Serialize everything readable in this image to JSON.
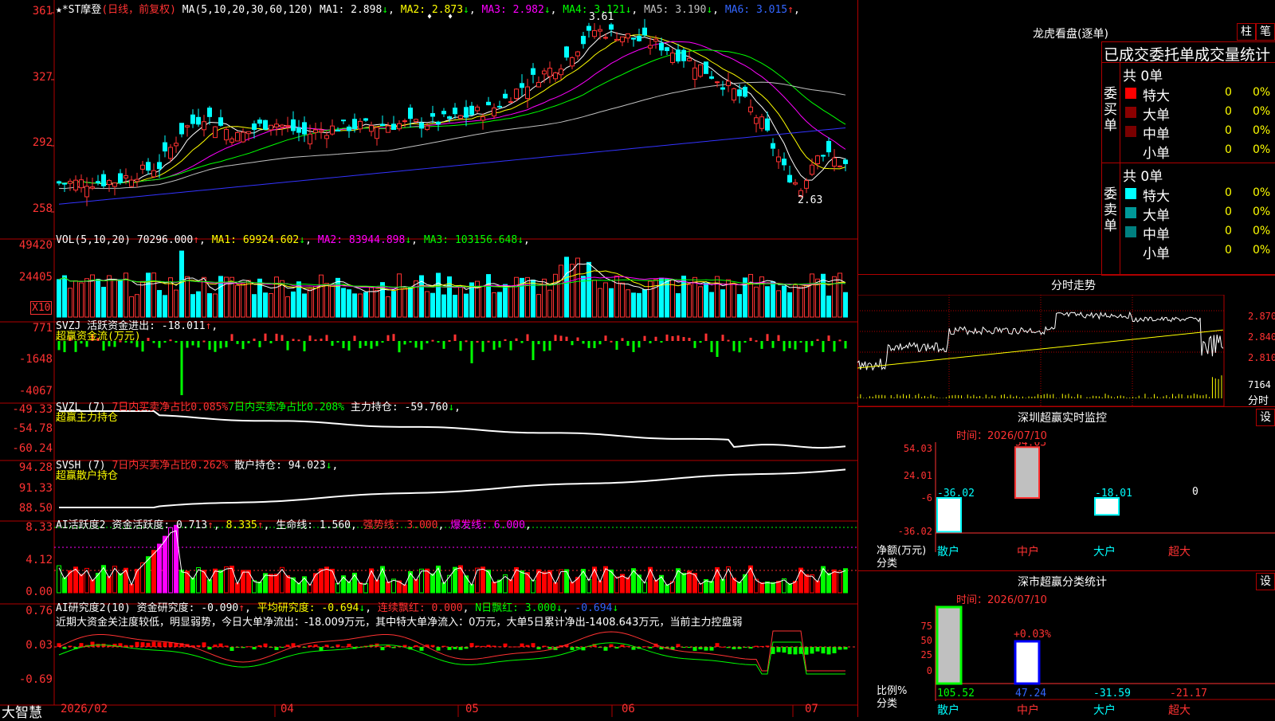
{
  "main": {
    "title": "★*ST摩登",
    "subtitle": "(日线，前复权)",
    "ma_label": "MA(5,10,20,30,60,120)",
    "ma": [
      {
        "name": "MA1:",
        "value": "2.898",
        "arrow": "↓",
        "color": "#ffffff"
      },
      {
        "name": "MA2:",
        "value": "2.873",
        "arrow": "↓",
        "color": "#ffff00"
      },
      {
        "name": "MA3:",
        "value": "2.982",
        "arrow": "↓",
        "color": "#ff00ff"
      },
      {
        "name": "MA4:",
        "value": "3.121",
        "arrow": "↓",
        "color": "#00ff00"
      },
      {
        "name": "MA5:",
        "value": "3.190",
        "arrow": "↓",
        "color": "#c0c0c0"
      },
      {
        "name": "MA6:",
        "value": "3.015",
        "arrow": "↑",
        "color": "#3366ff"
      }
    ],
    "y_labels": [
      "361",
      "327",
      "292",
      "258"
    ],
    "high_label": "3.61",
    "low_label": "2.63"
  },
  "vol": {
    "label": "VOL(5,10,20)",
    "value": "70296.000",
    "arrow": "↑",
    "ma": [
      {
        "name": "MA1:",
        "value": "69924.602",
        "arrow": "↓",
        "color": "#ffff00"
      },
      {
        "name": "MA2:",
        "value": "83944.898",
        "arrow": "↓",
        "color": "#ff00ff"
      },
      {
        "name": "MA3:",
        "value": "103156.648",
        "arrow": "↓",
        "color": "#00ff00"
      }
    ],
    "y_labels": [
      "49420",
      "24405"
    ],
    "unit": "X10"
  },
  "svzj": {
    "label": "SVZJ",
    "name": "活跃资金进出:",
    "value": "-18.011",
    "arrow": "↑",
    "sub": "超赢资金流(万元)",
    "y_labels": [
      "771",
      "-1648",
      "-4067"
    ]
  },
  "svzl": {
    "label": "SVZL (7)",
    "t1": "7日内买卖净占比0.085%",
    "t2": "7日内买卖净占比0.208%",
    "t3": "主力持仓:",
    "value": "-59.760",
    "arrow": "↓",
    "sub": "超赢主力持仓",
    "y_labels": [
      "-49.33",
      "-54.78",
      "-60.24"
    ]
  },
  "svsh": {
    "label": "SVSH (7)",
    "t1": "7日内买卖净占比0.262%",
    "t2": "散户持仓:",
    "value": "94.023",
    "arrow": "↓",
    "sub": "超赢散户持仓",
    "y_labels": [
      "94.28",
      "91.33",
      "88.50"
    ]
  },
  "ai1": {
    "label": "AI活跃度2",
    "t1": "资金活跃度:",
    "v1": "0.713",
    "v2": "8.335",
    "t3": "生命线:",
    "v3": "1.560",
    "t4": "强势线:",
    "v4": "3.000",
    "t5": "爆发线:",
    "v5": "6.000",
    "y_labels": [
      "8.33",
      "4.12",
      "0.00"
    ]
  },
  "ai2": {
    "label": "AI研究度2(10)",
    "t1": "资金研究度:",
    "v1": "-0.090",
    "t2": "平均研究度:",
    "v2": "-0.694",
    "t3": "连续飘红:",
    "v3": "0.000",
    "t4": "N日飘红:",
    "v4": "3.000",
    "v5": "-0.694",
    "comment": "近期大资金关注度较低，明显弱势，今日大单净流出：-18.009万元，其中特大单净流入：0万元，大单5日累计净出-1408.643万元，当前主力控盘弱",
    "y_labels": [
      "0.76",
      "0.03",
      "-0.69"
    ]
  },
  "xaxis": {
    "brand": "大智慧",
    "labels": [
      "2026/02",
      "04",
      "05",
      "06",
      "07"
    ]
  },
  "right": {
    "lhb_title": "龙虎看盘(逐单)",
    "btn_bar": "柱",
    "btn_pen": "笔",
    "stats_title": "已成交委托单成交量统计",
    "buy_label": "委买单",
    "sell_label": "委卖单",
    "buy_total": "共 0单",
    "sell_total": "共 0单",
    "buy_rows": [
      {
        "name": "特大",
        "count": "0",
        "pct": "0%",
        "color": "#ff0000"
      },
      {
        "name": "大单",
        "count": "0",
        "pct": "0%",
        "color": "#8b0000"
      },
      {
        "name": "中单",
        "count": "0",
        "pct": "0%",
        "color": "#7a0000"
      },
      {
        "name": "小单",
        "count": "0",
        "pct": "0%",
        "color": ""
      }
    ],
    "sell_rows": [
      {
        "name": "特大",
        "count": "0",
        "pct": "0%",
        "color": "#00ffff"
      },
      {
        "name": "大单",
        "count": "0",
        "pct": "0%",
        "color": "#009999"
      },
      {
        "name": "中单",
        "count": "0",
        "pct": "0%",
        "color": "#008080"
      },
      {
        "name": "小单",
        "count": "0",
        "pct": "0%",
        "color": ""
      }
    ],
    "intraday_title": "分时走势",
    "intraday_y": [
      "2.870",
      "2.840",
      "2.810"
    ],
    "intraday_vol": "7164",
    "intraday_vol_label": "分时",
    "monitor_title": "深圳超赢实时监控",
    "monitor_time": "时间：2026/07/10",
    "monitor_y": [
      "54.03",
      "24.01",
      "-6",
      "-36.02"
    ],
    "monitor_vals": [
      "-36.02",
      "54.03",
      "-18.01",
      "0"
    ],
    "monitor_unit": "净额(万元)",
    "monitor_cat_label": "分类",
    "monitor_cats": [
      "散户",
      "中户",
      "大户",
      "超大"
    ],
    "class_title": "深市超赢分类统计",
    "class_time": "时间：2026/07/10",
    "class_y": [
      "75",
      "50",
      "25",
      "0"
    ],
    "class_vals": [
      "105.52",
      "47.24",
      "-31.59",
      "-21.17"
    ],
    "class_top": "+0.03%",
    "class_unit": "比例%",
    "class_cat_label": "分类",
    "class_cats": [
      "散户",
      "中户",
      "大户",
      "超大"
    ],
    "settings": "设"
  }
}
